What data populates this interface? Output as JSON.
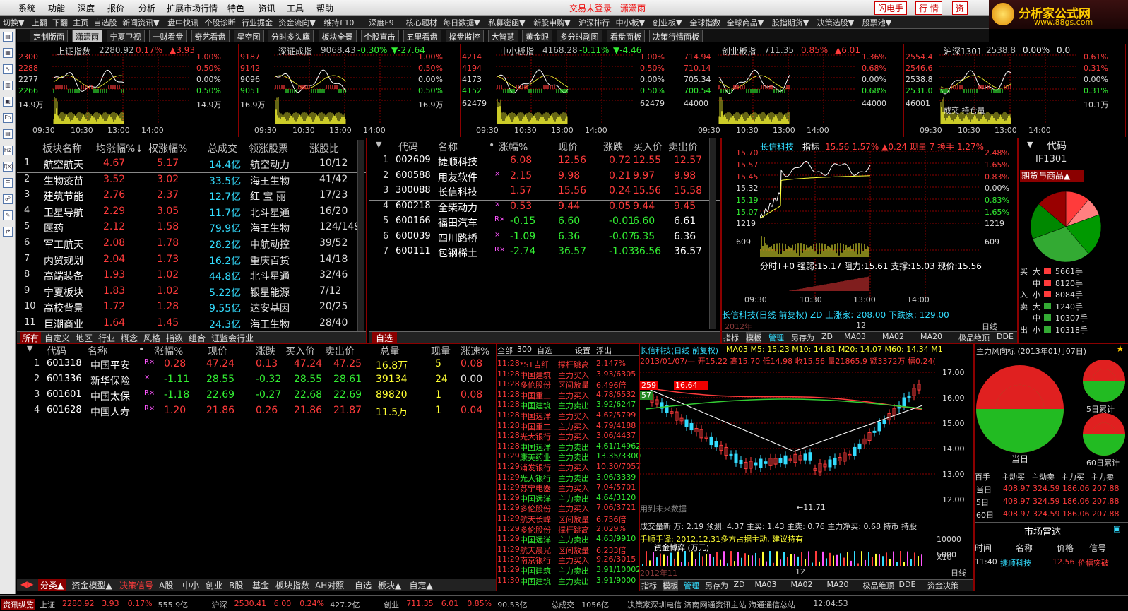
{
  "menu": {
    "items": [
      "系统",
      "功能",
      "深度",
      "报价",
      "分析",
      "扩展市场行情",
      "特色",
      "资讯",
      "工具",
      "帮助"
    ],
    "center": "交易未登录",
    "center2": "潇潇雨",
    "right_btns": [
      "闪电手",
      "行 情",
      "资"
    ]
  },
  "logo": {
    "text": "分析家公式网",
    "url": "www.88gs.com"
  },
  "toolbar": [
    "切换▼",
    "上翻",
    "下翻",
    "主页",
    "自选股",
    "新闻资讯▼",
    "盘中快讯",
    "个股诊断",
    "行业掘金",
    "资金流向▼",
    "维持£10",
    "深度F9",
    "核心题材",
    "每日数据▼",
    "私募密函▼",
    "新股申购▼",
    "沪深排行",
    "中小板▼",
    "创业板▼",
    "全球指数",
    "全球商品▼",
    "股指期货▼",
    "决策选股▼",
    "股票池▼"
  ],
  "tabs": [
    "定制版面",
    "潇潇雨",
    "宁夏卫视",
    "一财看盘",
    "奇艺看盘",
    "星空图",
    "分时多头鹰",
    "板块全景",
    "个股直击",
    "五里看盘",
    "操盘监控",
    "大智慧",
    "黄金眼",
    "多分时副图",
    "看盘面板",
    "决策行情面板"
  ],
  "minicharts": [
    {
      "name": "上证指数",
      "val": "2280.92",
      "pct": "0.17%",
      "chg": "▲3.93",
      "y": [
        "2300",
        "2288",
        "2277",
        "2266",
        "14.9万"
      ],
      "r": [
        "1.00%",
        "0.50%",
        "0.00%",
        "0.50%",
        "14.9万"
      ],
      "t": [
        "09:30",
        "10:30",
        "13:00",
        "14:00"
      ]
    },
    {
      "name": "深证成指",
      "val": "9068.43",
      "pct": "-0.30%",
      "chg": "▼-27.64",
      "y": [
        "9187",
        "9142",
        "9096",
        "9051",
        "16.9万"
      ],
      "r": [
        "1.00%",
        "0.50%",
        "0.00%",
        "0.50%",
        "16.9万"
      ],
      "t": [
        "09:30",
        "10:30",
        "13:00",
        "14:00"
      ]
    },
    {
      "name": "中小板指",
      "val": "4168.28",
      "pct": "-0.11%",
      "chg": "▼-4.46",
      "y": [
        "4214",
        "4194",
        "4173",
        "4152",
        "62479"
      ],
      "r": [
        "1.00%",
        "0.50%",
        "0.00%",
        "0.50%",
        "62479"
      ],
      "t": [
        "09:30",
        "10:30",
        "13:00",
        "14:00"
      ]
    },
    {
      "name": "创业板指",
      "val": "711.35",
      "pct": "0.85%",
      "chg": "▲6.01",
      "y": [
        "714.94",
        "710.14",
        "705.34",
        "700.54",
        "44000"
      ],
      "r": [
        "1.36%",
        "0.68%",
        "0.00%",
        "0.68%",
        "44000"
      ],
      "t": [
        "09:30",
        "10:30",
        "13:00",
        "14:00"
      ]
    },
    {
      "name": "沪深1301",
      "val": "2538.8",
      "pct": "0.00%",
      "chg": "0.0",
      "y": [
        "2554.4",
        "2546.6",
        "2538.8",
        "2531.0",
        "46001"
      ],
      "r": [
        "0.61%",
        "0.31%",
        "0.00%",
        "0.31%",
        "10.1万"
      ],
      "t": [
        "09:30",
        "10:30",
        "13:00",
        "14:00"
      ],
      "note": "成交 持仓量"
    }
  ],
  "sector": {
    "headers": [
      "板块名称",
      "均涨幅%↓",
      "权涨幅%",
      "总成交",
      "领涨股票",
      "涨股比"
    ],
    "rows": [
      [
        "1",
        "航空航天",
        "4.67",
        "5.17",
        "14.4亿",
        "航空动力",
        "10/12"
      ],
      [
        "2",
        "生物疫苗",
        "3.52",
        "3.02",
        "33.5亿",
        "海王生物",
        "41/42"
      ],
      [
        "3",
        "建筑节能",
        "2.76",
        "2.37",
        "12.7亿",
        "红 宝 丽",
        "17/23"
      ],
      [
        "4",
        "卫星导航",
        "2.29",
        "3.05",
        "11.7亿",
        "北斗星通",
        "16/20"
      ],
      [
        "5",
        "医药",
        "2.12",
        "1.58",
        "79.9亿",
        "海王生物",
        "124/149"
      ],
      [
        "6",
        "军工航天",
        "2.08",
        "1.78",
        "28.2亿",
        "中航动控",
        "39/52"
      ],
      [
        "7",
        "内贸规划",
        "2.04",
        "1.73",
        "16.2亿",
        "重庆百货",
        "14/18"
      ],
      [
        "8",
        "高端装备",
        "1.93",
        "1.02",
        "44.8亿",
        "北斗星通",
        "32/46"
      ],
      [
        "9",
        "宁夏板块",
        "1.83",
        "1.02",
        "5.22亿",
        "银星能源",
        "7/12"
      ],
      [
        "10",
        "高校背景",
        "1.72",
        "1.28",
        "9.55亿",
        "达安基因",
        "20/25"
      ],
      [
        "11",
        "巨潮商业",
        "1.64",
        "1.45",
        "24.3亿",
        "海王生物",
        "28/40"
      ]
    ],
    "tabs": [
      "所有",
      "自定义",
      "地区",
      "行业",
      "概念",
      "风格",
      "指数",
      "组合",
      "证监会行业"
    ]
  },
  "watch": {
    "headers": [
      "代码",
      "名称",
      "•",
      "涨幅%",
      "现价",
      "涨跌",
      "买入价",
      "卖出价"
    ],
    "rows": [
      [
        "1",
        "002609",
        "捷顺科技",
        "",
        "6.08",
        "12.56",
        "0.72",
        "12.55",
        "12.57"
      ],
      [
        "2",
        "600588",
        "用友软件",
        "×",
        "2.15",
        "9.98",
        "0.21",
        "9.97",
        "9.98"
      ],
      [
        "3",
        "300088",
        "长信科技",
        "",
        "1.57",
        "15.56",
        "0.24",
        "15.56",
        "15.58"
      ],
      [
        "4",
        "600218",
        "全柴动力",
        "×",
        "0.53",
        "9.44",
        "0.05",
        "9.44",
        "9.45"
      ],
      [
        "5",
        "600166",
        "福田汽车",
        "R×",
        "-0.15",
        "6.60",
        "-0.01",
        "6.60",
        "6.61"
      ],
      [
        "6",
        "600039",
        "四川路桥",
        "×",
        "-1.09",
        "6.36",
        "-0.07",
        "6.35",
        "6.36"
      ],
      [
        "7",
        "600111",
        "包钢稀土",
        "R×",
        "-2.74",
        "36.57",
        "-1.03",
        "36.56",
        "36.57"
      ]
    ],
    "tab": "自选"
  },
  "intraday": {
    "title": "长信科技",
    "label": "指标",
    "info": "15.56 1.57% ▲0.24 现量 7 换手 1.27%",
    "y": [
      "15.70",
      "15.57",
      "15.45",
      "15.32",
      "15.19",
      "15.07",
      "1219",
      "609"
    ],
    "r": [
      "2.48%",
      "1.65%",
      "0.83%",
      "0.00%",
      "0.83%",
      "1.65%",
      "1219",
      "609"
    ],
    "sub": "分时T+0 强弱:15.17 阻力:15.61 支撑:15.03 现价:15.56",
    "t": [
      "09:30",
      "10:30",
      "13:00",
      "14:00"
    ],
    "foot": "长信科技(日线 前复权) ZD 上涨家: 208.00 下跌家: 129.00",
    "foot2": "2012年",
    "foot3": "12",
    "foot4": "日线",
    "tabs": [
      "指标",
      "模板",
      "管理",
      "另存为",
      "ZD",
      "MA03",
      "MA02",
      "MA20",
      "极品绝顶",
      "DDE"
    ]
  },
  "rightpanel": {
    "hdr": "代码",
    "code": "IF1301",
    "title": "期货与商品▲",
    "buy": [
      [
        "买",
        "大",
        "5661手"
      ],
      [
        "",
        "中",
        "8120手"
      ],
      [
        "入",
        "小",
        "8084手"
      ]
    ],
    "sell": [
      [
        "卖",
        "大",
        "1240手"
      ],
      [
        "",
        "中",
        "10307手"
      ],
      [
        "出",
        "小",
        "10318手"
      ]
    ]
  },
  "holdings": {
    "headers": [
      "代码",
      "名称",
      "•",
      "涨幅%",
      "现价",
      "涨跌",
      "买入价",
      "卖出价",
      "总量",
      "现量",
      "涨速%"
    ],
    "rows": [
      [
        "1",
        "601318",
        "中国平安",
        "R×",
        "0.28",
        "47.24",
        "0.13",
        "47.24",
        "47.25",
        "16.8万",
        "5",
        "0.08"
      ],
      [
        "2",
        "601336",
        "新华保险",
        "×",
        "-1.11",
        "28.55",
        "-0.32",
        "28.55",
        "28.61",
        "39134",
        "24",
        "0.00"
      ],
      [
        "3",
        "601601",
        "中国太保",
        "R×",
        "-1.18",
        "22.69",
        "-0.27",
        "22.68",
        "22.69",
        "89820",
        "1",
        "0.08"
      ],
      [
        "4",
        "601628",
        "中国人寿",
        "R×",
        "1.20",
        "21.86",
        "0.26",
        "21.86",
        "21.87",
        "11.5万",
        "1",
        "0.04"
      ]
    ],
    "tabs": [
      "分类▲",
      "资金模型▲",
      "决策信号",
      "A股",
      "中小",
      "创业",
      "B股",
      "基金",
      "板块指数",
      "AH对照",
      "自选",
      "板块▲",
      "自定▲"
    ]
  },
  "ticker": {
    "hdr": [
      "全部",
      "300",
      "自选",
      "设置",
      "浮出"
    ],
    "rows": [
      [
        "11:28",
        "*ST吉纤",
        "撑杆跳高",
        "2.147%"
      ],
      [
        "11:28",
        "中国建筑",
        "主力买入",
        "3.93/6305"
      ],
      [
        "11:28",
        "多伦股份",
        "区间放量",
        "6.496倍"
      ],
      [
        "11:28",
        "中国重工",
        "主力买入",
        "4.78/6532"
      ],
      [
        "11:28",
        "中国建筑",
        "主力卖出",
        "3.92/6247"
      ],
      [
        "11:28",
        "中国远洋",
        "主力买入",
        "4.62/5799"
      ],
      [
        "11:28",
        "中国重工",
        "主力买入",
        "4.79/4188"
      ],
      [
        "11:28",
        "光大银行",
        "主力买入",
        "3.06/4437"
      ],
      [
        "11:28",
        "中国远洋",
        "主力卖出",
        "4.61/14962"
      ],
      [
        "11:29",
        "康美药业",
        "主力卖出",
        "13.35/3300"
      ],
      [
        "11:29",
        "浦发银行",
        "主力买入",
        "10.30/7057"
      ],
      [
        "11:29",
        "光大银行",
        "主力卖出",
        "3.06/3339"
      ],
      [
        "11:29",
        "苏宁电器",
        "主力买入",
        "7.04/5701"
      ],
      [
        "11:29",
        "中国远洋",
        "主力卖出",
        "4.64/3120"
      ],
      [
        "11:29",
        "多伦股份",
        "主力买入",
        "7.06/3721"
      ],
      [
        "11:29",
        "航天长峰",
        "区间放量",
        "6.756倍"
      ],
      [
        "11:29",
        "多伦股份",
        "撑杆跳高",
        "2.029%"
      ],
      [
        "11:29",
        "中国远洋",
        "主力卖出",
        "4.63/9910"
      ],
      [
        "11:29",
        "航天晨光",
        "区间放量",
        "6.233倍"
      ],
      [
        "11:29",
        "南京银行",
        "主力买入",
        "9.26/3015"
      ],
      [
        "11:29",
        "中国建筑",
        "主力卖出",
        "3.91/10002"
      ],
      [
        "11:30",
        "中国建筑",
        "主力卖出",
        "3.91/9000"
      ]
    ]
  },
  "kline": {
    "title": "长信科技(日线 前复权)",
    "ma": "MA03 M5: 15.23 M10: 14.81 M20: 14.07 M60: 14.34 M1",
    "info": "2013/01/07/— 开15.22 高15.70 低14.98 收15.56 量21865.9 额3372万 幅0.24(1",
    "y": [
      "17.00",
      "16.00",
      "15.00",
      "14.00",
      "13.00",
      "12.00"
    ],
    "lowlabel": "←11.71",
    "flag": "259",
    "flag2": "16.64",
    "flag3": "57",
    "note": "用到未来数据",
    "vol": "成交量新 万: 2.19 预测: 4.37 主买: 1.43 主卖: 0.76 主力净买: 0.68 持币 持股",
    "vol2": "手顺手译: 2012.12.31多方占据主动, 建议持有",
    "vol3": "资金博弈 (万元)",
    "vy": [
      "10000",
      "5000"
    ],
    "foot": "2012年11",
    "foot2": "12",
    "foot3": "X10",
    "foot4": "日线",
    "tabs": [
      "指标",
      "模板",
      "管理",
      "另存为",
      "ZD",
      "MA03",
      "MA02",
      "MA20",
      "极品绝顶",
      "DDE",
      "资金决策"
    ]
  },
  "mainflow": {
    "title": "主力风向标 (2013年01月07日)",
    "l1": "当日",
    "l2": "5日累计",
    "l3": "60日累计",
    "headers": [
      "百手",
      "主动买",
      "主动卖",
      "主力买",
      "主力卖"
    ],
    "rows": [
      [
        "当日",
        "408.97",
        "324.59",
        "186.06",
        "207.88"
      ],
      [
        "5日",
        "408.97",
        "324.59",
        "186.06",
        "207.88"
      ],
      [
        "60日",
        "408.97",
        "324.59",
        "186.06",
        "207.88"
      ]
    ],
    "radar": "市场雷达",
    "rh": [
      "时间",
      "名称",
      "价格",
      "信号"
    ],
    "rr": [
      "11:40",
      "捷顺科技",
      "12.56",
      "价幅突破"
    ]
  },
  "status": [
    {
      "t": "资讯纵览",
      "c": "#ff3b3b"
    },
    {
      "t": "上证",
      "c": "#c0c0c0"
    },
    {
      "t": "2280.92",
      "c": "#ff3b3b"
    },
    {
      "t": "3.93",
      "c": "#ff3b3b"
    },
    {
      "t": "0.17%",
      "c": "#ff3b3b"
    },
    {
      "t": "555.9亿",
      "c": "#c0c0c0"
    },
    {
      "t": "沪深",
      "c": "#c0c0c0"
    },
    {
      "t": "2530.41",
      "c": "#ff3b3b"
    },
    {
      "t": "6.00",
      "c": "#ff3b3b"
    },
    {
      "t": "0.24%",
      "c": "#ff3b3b"
    },
    {
      "t": "427.2亿",
      "c": "#c0c0c0"
    },
    {
      "t": "创业",
      "c": "#c0c0c0"
    },
    {
      "t": "711.35",
      "c": "#ff3b3b"
    },
    {
      "t": "6.01",
      "c": "#ff3b3b"
    },
    {
      "t": "0.85%",
      "c": "#ff3b3b"
    },
    {
      "t": "90.53亿",
      "c": "#c0c0c0"
    },
    {
      "t": "总成交",
      "c": "#c0c0c0"
    },
    {
      "t": "1056亿",
      "c": "#c0c0c0"
    },
    {
      "t": "决策家深圳电信 济南网通资讯主站 海通通信总站",
      "c": "#c0c0c0"
    },
    {
      "t": "12:04:53",
      "c": "#c0c0c0"
    }
  ]
}
